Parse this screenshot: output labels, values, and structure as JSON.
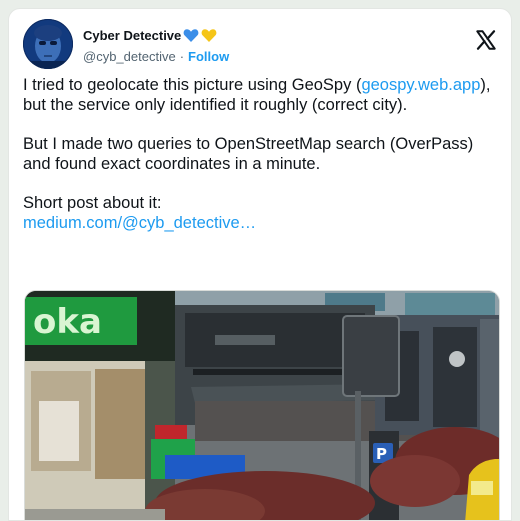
{
  "author": {
    "display_name": "Cyber Detective",
    "badges": [
      "blue-heart-icon",
      "yellow-heart-icon"
    ],
    "badge_colors": [
      "#3b8ee8",
      "#f5c518"
    ],
    "handle": "@cyb_detective",
    "separator": "·",
    "follow_label": "Follow"
  },
  "platform_icon": "x-logo-icon",
  "post": {
    "p1_before": "I tried to geolocate this picture using GeoSpy (",
    "p1_link": "geospy.web.app",
    "p1_after": "), but the service only identified it roughly (correct city).",
    "p2": "But I made two queries to OpenStreetMap search (OverPass) and found exact coordinates in a minute.",
    "p3": "Short post about it:",
    "p3_link": "medium.com/@cyb_detective…"
  },
  "photo": {
    "sign_text": "oka",
    "parking_sign": "P"
  },
  "colors": {
    "link": "#1d9bf0",
    "secondary_text": "#536471",
    "text": "#0f1419",
    "sign_green": "#1f9a3f"
  }
}
